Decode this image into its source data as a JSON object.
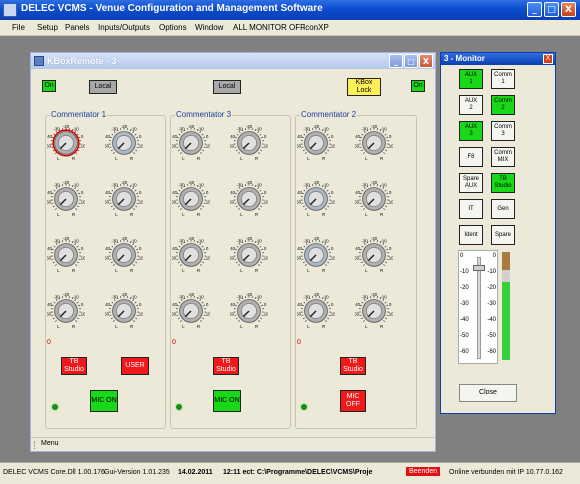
{
  "app": {
    "title": "DELEC VCMS - Venue Configuration and Management Software",
    "window_buttons": [
      "_",
      "□",
      "X"
    ]
  },
  "menu": [
    "File",
    "Setup",
    "Panels",
    "Inputs/Outputs",
    "Options",
    "Window",
    "ALL MONITOR OFF",
    "IconXP"
  ],
  "kbox": {
    "title": "KBoxRemote - 3",
    "top_buttons": {
      "on_left": "On",
      "local_left": "Local",
      "local_mid": "Local",
      "kbox_lock": "KBox\nLock",
      "on_right": "On"
    },
    "groups": [
      {
        "label": "Commentator 1",
        "zero": "0",
        "tb": "TB\nStudio",
        "extra": "USER",
        "mic": "MIC ON",
        "mic_state": "on"
      },
      {
        "label": "Commentator 3",
        "zero": "0",
        "tb": "TB\nStudio",
        "extra": "",
        "mic": "MIC ON",
        "mic_state": "on"
      },
      {
        "label": "Commentator 2",
        "zero": "0",
        "tb": "TB\nStudio",
        "extra": "",
        "mic": "MIC\nOFF",
        "mic_state": "off"
      }
    ],
    "knob_scale": [
      "-30",
      "-20",
      "-10",
      "-40",
      "0",
      "-50",
      "10"
    ],
    "knob_ends": [
      "L",
      "R"
    ],
    "menu_label": "Menu"
  },
  "monitor": {
    "title": "3 - Monitor",
    "buttons": [
      {
        "label": "AUX\n1",
        "state": "green"
      },
      {
        "label": "Comm\n1",
        "state": "white"
      },
      {
        "label": "AUX\n2",
        "state": "white"
      },
      {
        "label": "Comm\n2",
        "state": "green"
      },
      {
        "label": "AUX\n3",
        "state": "green"
      },
      {
        "label": "Comm\n3",
        "state": "white"
      },
      {
        "label": "F8",
        "state": "white"
      },
      {
        "label": "Comm\nMIX",
        "state": "white"
      },
      {
        "label": "Spare\nAUX",
        "state": "white"
      },
      {
        "label": "TB\nStudio",
        "state": "green"
      },
      {
        "label": "IT",
        "state": "white"
      },
      {
        "label": "Gen",
        "state": "white"
      },
      {
        "label": "Ident",
        "state": "white"
      },
      {
        "label": "Spare",
        "state": "white"
      }
    ],
    "meter_left_ticks": [
      "0",
      "-10",
      "-20",
      "-30",
      "-40",
      "-50",
      "-60"
    ],
    "meter_right_ticks": [
      "0",
      "-10",
      "-20",
      "-30",
      "-40",
      "-50",
      "-60"
    ],
    "fader_level_db": -5,
    "vu_level_fraction": 0.72,
    "close_label": "Close"
  },
  "status": {
    "core": "DELEC VCMS Core.Dll 1.00.176",
    "gui": "Gui-Version 1.01.235",
    "date": "14.02.2011",
    "time_path": "12:11 ect: C:\\Programme\\DELEC\\VCMS\\Proje",
    "beenden": "Beenden",
    "online": "Online verbunden mit IP 10.77.0.162"
  },
  "colors": {
    "green": "#18d818",
    "red": "#f01818",
    "yellow": "#fff05a",
    "gray": "#a8a8a8"
  }
}
